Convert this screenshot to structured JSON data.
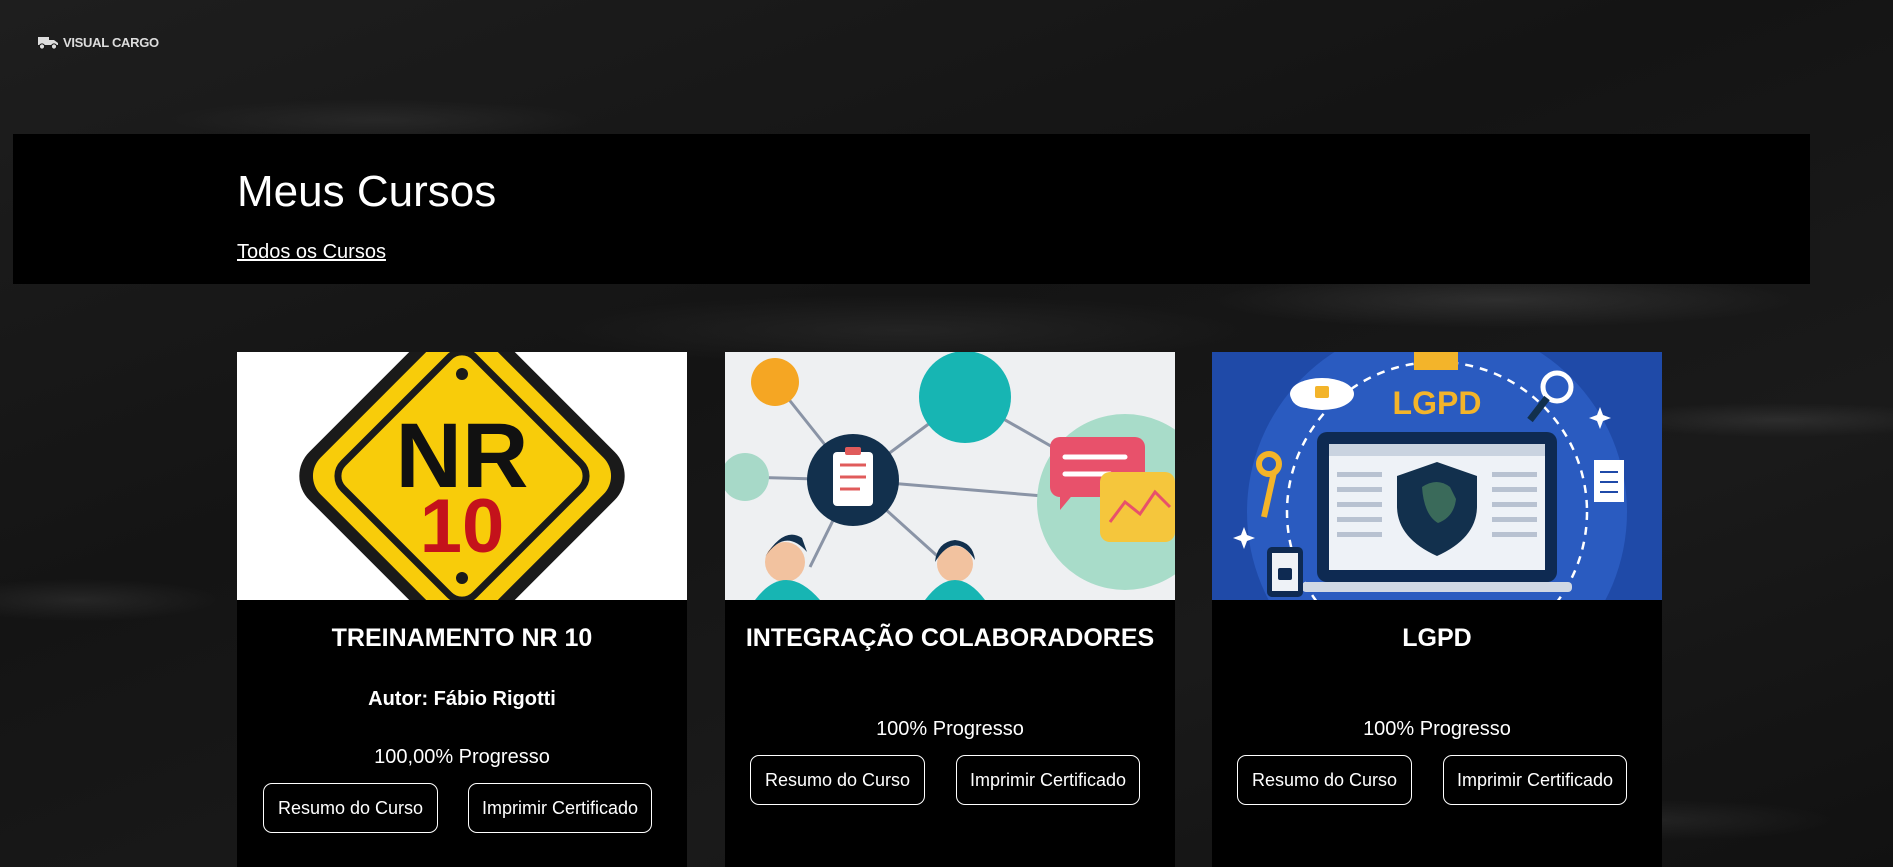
{
  "brand": {
    "name": "VISUAL CARGO",
    "icon": "truck-logo-icon"
  },
  "header": {
    "title": "Meus Cursos",
    "all_courses_link": "Todos os Cursos"
  },
  "courses": [
    {
      "title": "TREINAMENTO NR 10",
      "author": "Autor: Fábio Rigotti",
      "progress_text": "100,00% Progresso",
      "progress": 100,
      "summary_button": "Resumo do Curso",
      "certificate_button": "Imprimir Certificado",
      "image": {
        "label_line1": "NR",
        "label_line2": "10"
      }
    },
    {
      "title": "INTEGRAÇÃO COLABORADORES",
      "author": "",
      "progress_text": "100% Progresso",
      "progress": 100,
      "summary_button": "Resumo do Curso",
      "certificate_button": "Imprimir Certificado"
    },
    {
      "title": "LGPD",
      "author": "",
      "progress_text": "100% Progresso",
      "progress": 100,
      "summary_button": "Resumo do Curso",
      "certificate_button": "Imprimir Certificado",
      "image": {
        "label": "LGPD"
      }
    }
  ],
  "colors": {
    "background": "#161616",
    "card": "#000000",
    "nr10_yellow": "#f8cc0a",
    "nr10_red": "#c4121b",
    "lgpd_blue": "#1f4aa8",
    "lgpd_gold": "#f3b42a"
  }
}
